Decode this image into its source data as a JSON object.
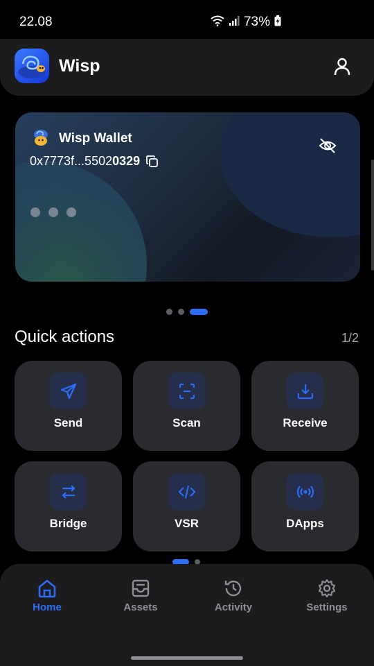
{
  "status_bar": {
    "time": "22.08",
    "battery": "73%"
  },
  "header": {
    "app_name": "Wisp"
  },
  "wallet_card": {
    "name": "Wisp Wallet",
    "address_prefix": "0x7773f...5502",
    "address_suffix": "0329",
    "balance_hidden_dots": 3,
    "pager_total": 3,
    "pager_active": 3
  },
  "quick_actions": {
    "title": "Quick actions",
    "page_indicator": "1/2",
    "items": [
      {
        "label": "Send",
        "icon": "send-icon"
      },
      {
        "label": "Scan",
        "icon": "scan-icon"
      },
      {
        "label": "Receive",
        "icon": "download-icon"
      },
      {
        "label": "Bridge",
        "icon": "bridge-arrows-icon"
      },
      {
        "label": "VSR",
        "icon": "code-icon"
      },
      {
        "label": "DApps",
        "icon": "broadcast-icon"
      }
    ]
  },
  "bottom_nav": {
    "items": [
      {
        "label": "Home",
        "icon": "home-icon",
        "active": true
      },
      {
        "label": "Assets",
        "icon": "inbox-icon",
        "active": false
      },
      {
        "label": "Activity",
        "icon": "history-icon",
        "active": false
      },
      {
        "label": "Settings",
        "icon": "gear-icon",
        "active": false
      }
    ]
  },
  "colors": {
    "accent": "#2d6cf6",
    "background": "#000000",
    "surface": "#1c1c1e",
    "tile": "#2a2b30"
  }
}
